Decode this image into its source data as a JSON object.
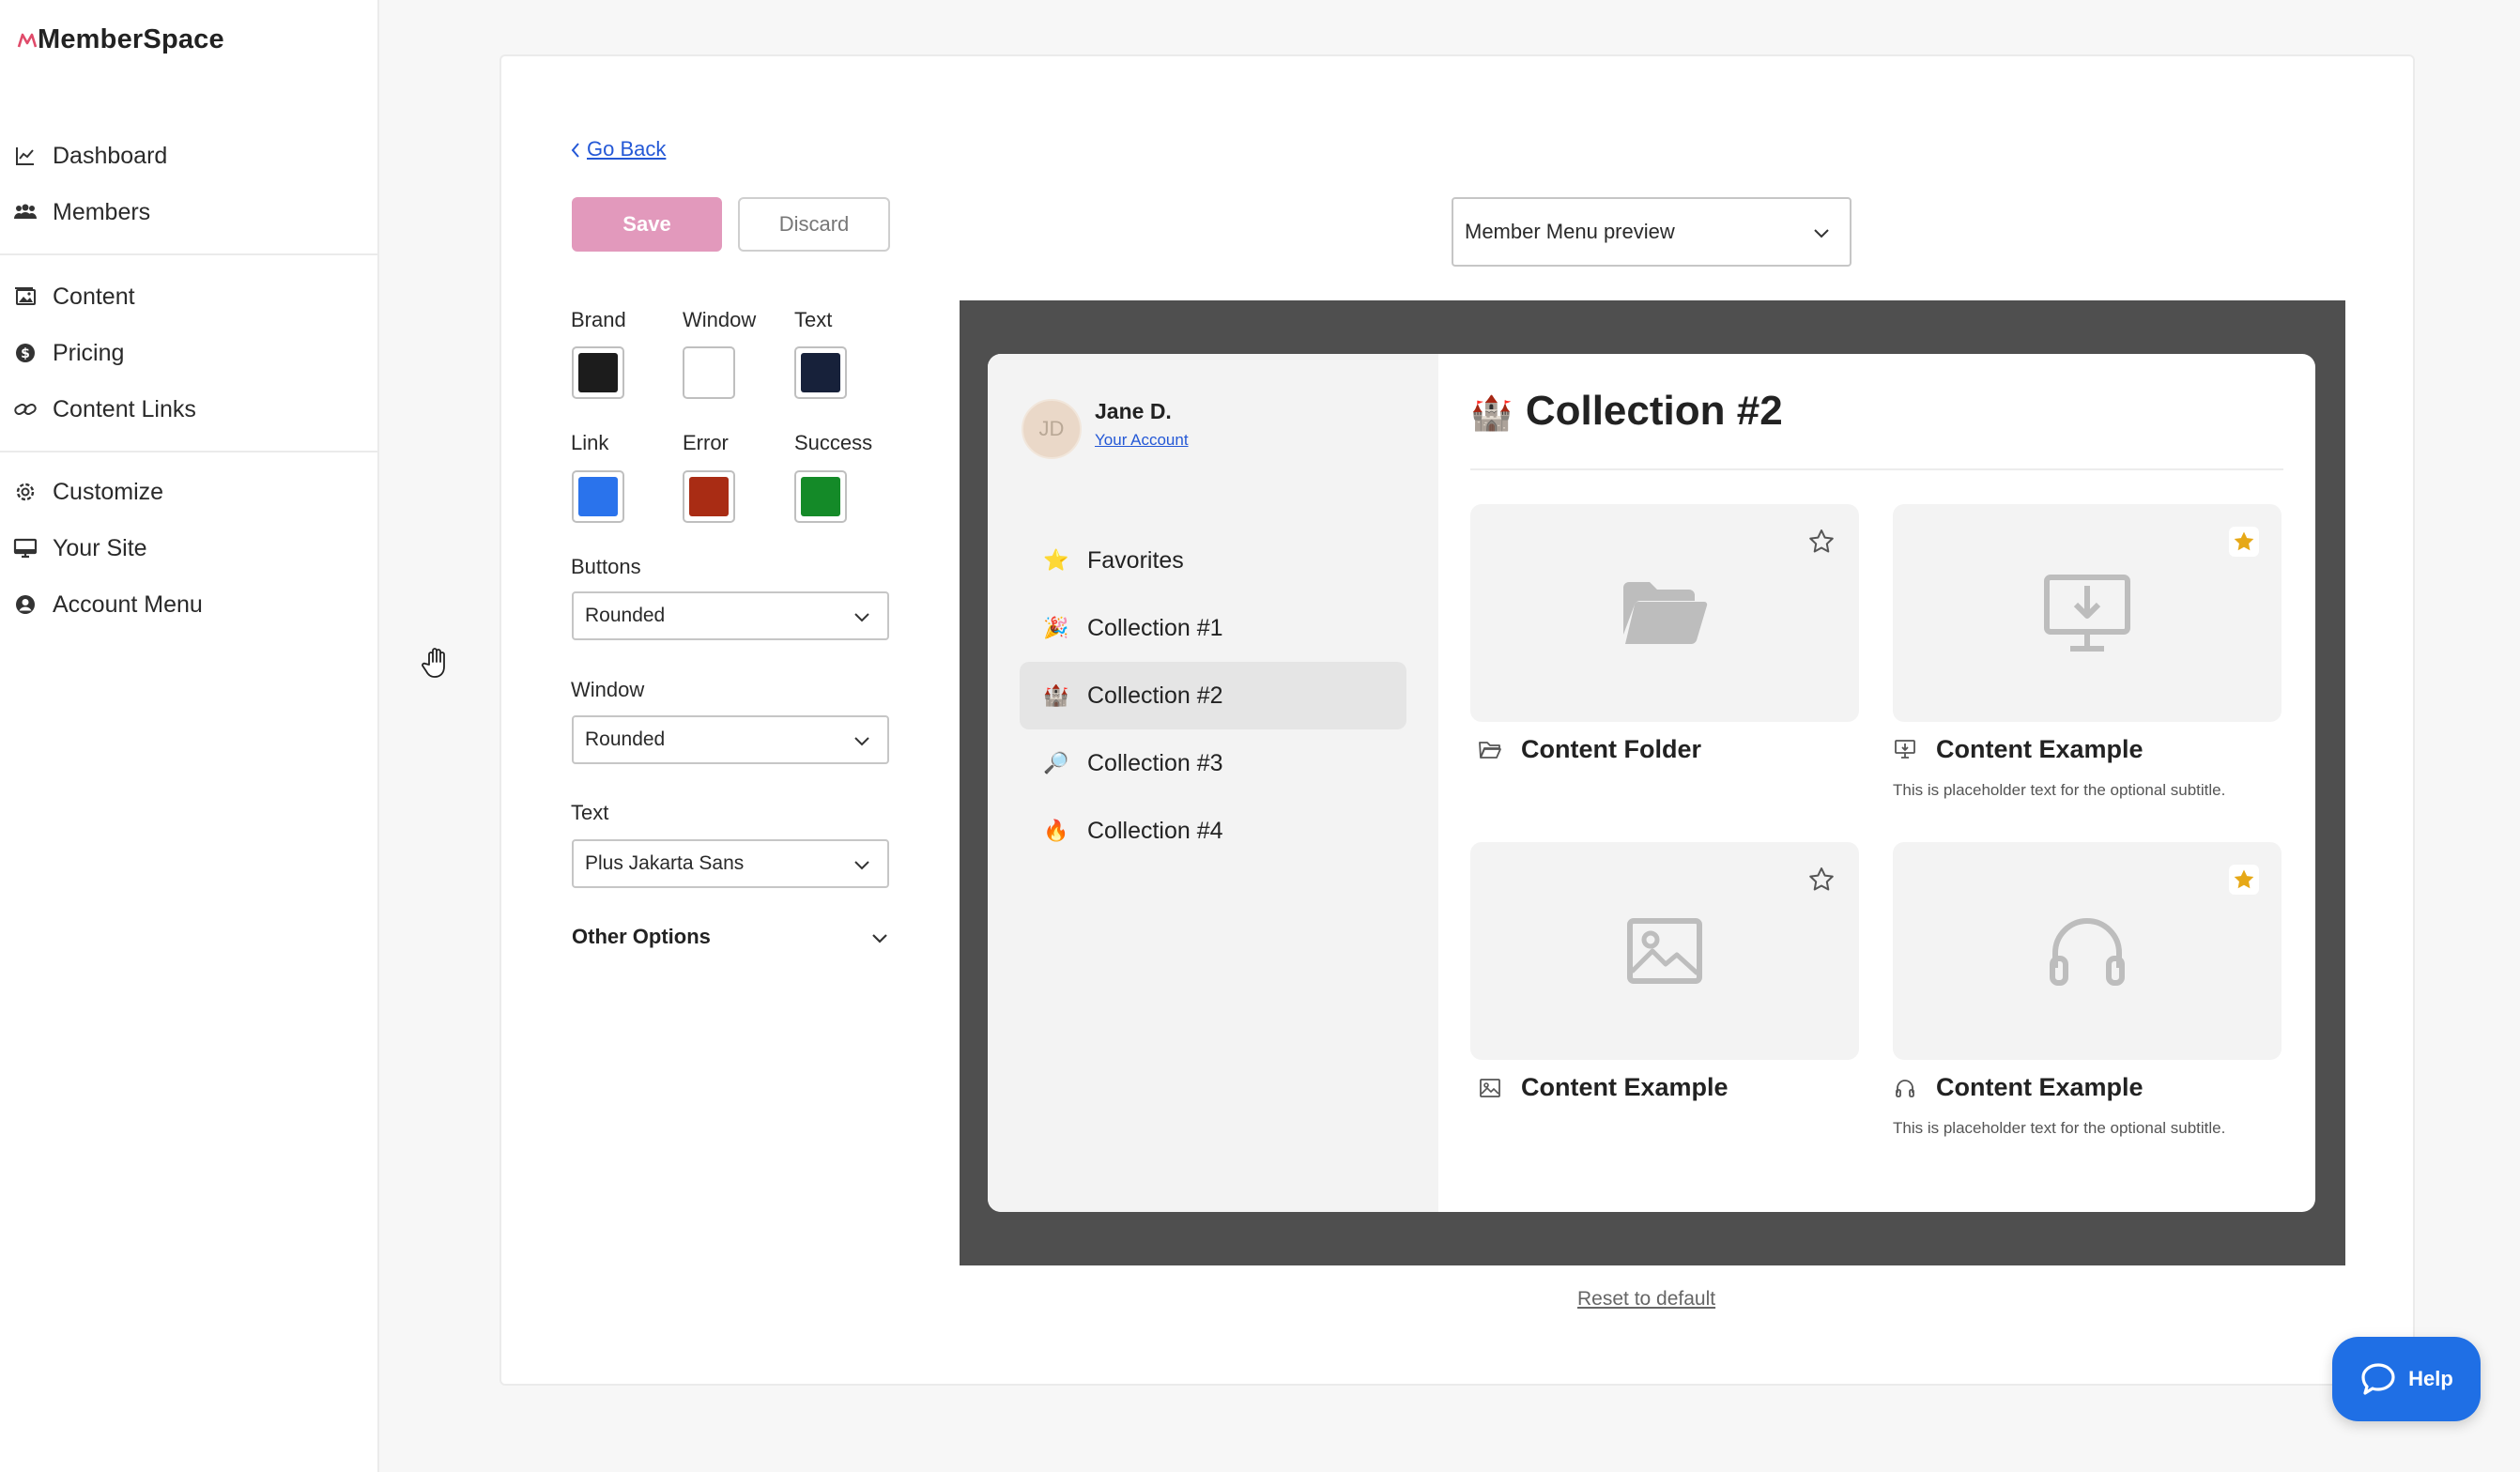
{
  "app": {
    "brand": "MemberSpace"
  },
  "sidebar": {
    "groups": [
      [
        {
          "label": "Dashboard",
          "icon": "chart-line-icon"
        },
        {
          "label": "Members",
          "icon": "users-icon"
        }
      ],
      [
        {
          "label": "Content",
          "icon": "image-icon"
        },
        {
          "label": "Pricing",
          "icon": "dollar-icon"
        },
        {
          "label": "Content Links",
          "icon": "link-icon"
        }
      ],
      [
        {
          "label": "Customize",
          "icon": "gear-icon"
        },
        {
          "label": "Your Site",
          "icon": "monitor-icon"
        },
        {
          "label": "Account Menu",
          "icon": "user-circle-icon"
        }
      ]
    ]
  },
  "editor": {
    "go_back": "Go Back",
    "save": "Save",
    "discard": "Discard",
    "colors": {
      "brand": {
        "label": "Brand",
        "value": "#1c1c1c"
      },
      "window": {
        "label": "Window",
        "value": "#ffffff"
      },
      "text": {
        "label": "Text",
        "value": "#17213a"
      },
      "link": {
        "label": "Link",
        "value": "#2a73ec"
      },
      "error": {
        "label": "Error",
        "value": "#a92c14"
      },
      "success": {
        "label": "Success",
        "value": "#148a28"
      }
    },
    "buttons": {
      "label": "Buttons",
      "value": "Rounded"
    },
    "window_style": {
      "label": "Window",
      "value": "Rounded"
    },
    "text_font": {
      "label": "Text",
      "value": "Plus Jakarta Sans"
    },
    "other_options": "Other Options",
    "reset": "Reset to default"
  },
  "preview": {
    "selector": "Member Menu preview",
    "user": {
      "initials": "JD",
      "name": "Jane D.",
      "account_link": "Your Account"
    },
    "menu": [
      {
        "label": "Favorites",
        "emoji": "⭐"
      },
      {
        "label": "Collection #1",
        "emoji": "🎉"
      },
      {
        "label": "Collection #2",
        "emoji": "🏰",
        "active": true
      },
      {
        "label": "Collection #3",
        "emoji": "🔎"
      },
      {
        "label": "Collection #4",
        "emoji": "🔥"
      }
    ],
    "collection_title": "Collection #2",
    "collection_emoji": "🏰",
    "tiles": [
      {
        "title": "Content Folder",
        "subtitle": "",
        "icon": "folder-icon",
        "favorited": false
      },
      {
        "title": "Content Example",
        "subtitle": "This is placeholder text for the optional subtitle.",
        "icon": "download-monitor-icon",
        "favorited": true
      },
      {
        "title": "Content Example",
        "subtitle": "",
        "icon": "image-icon",
        "favorited": false
      },
      {
        "title": "Content Example",
        "subtitle": "This is placeholder text for the optional subtitle.",
        "icon": "headphones-icon",
        "favorited": true
      }
    ]
  },
  "help": {
    "label": "Help"
  }
}
